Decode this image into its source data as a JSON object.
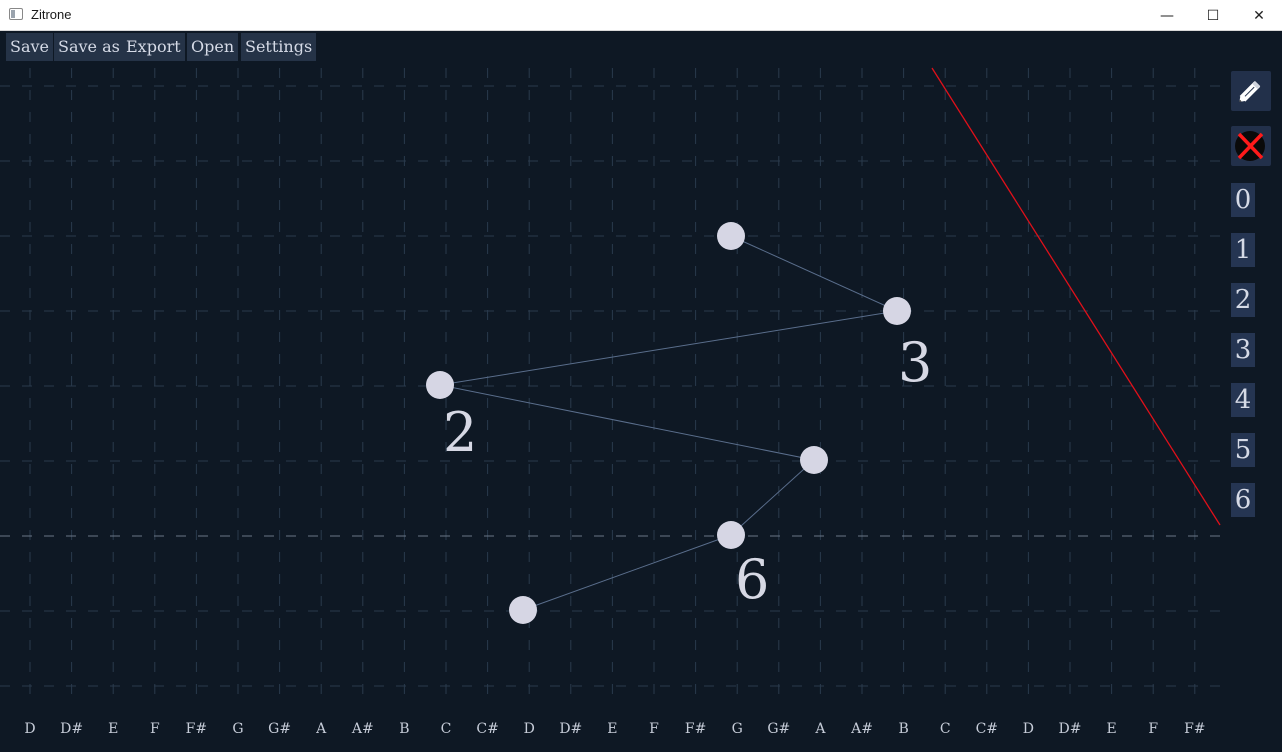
{
  "window": {
    "title": "Zitrone",
    "minimize_glyph": "—",
    "maximize_glyph": "☐",
    "close_glyph": "✕"
  },
  "menu": [
    {
      "key": "save",
      "label": "Save"
    },
    {
      "key": "save-as",
      "label": "Save as"
    },
    {
      "key": "export",
      "label": "Export"
    },
    {
      "key": "open",
      "label": "Open"
    },
    {
      "key": "settings",
      "label": "Settings"
    }
  ],
  "tools": [
    {
      "key": "pencil",
      "icon": "pencil-icon"
    },
    {
      "key": "delete",
      "icon": "red-x-icon"
    }
  ],
  "number_buttons": [
    "0",
    "1",
    "2",
    "3",
    "4",
    "5",
    "6"
  ],
  "note_labels": [
    "D",
    "D#",
    "E",
    "F",
    "F#",
    "G",
    "G#",
    "A",
    "A#",
    "B",
    "C",
    "C#",
    "D",
    "D#",
    "E",
    "F",
    "F#",
    "G",
    "G#",
    "A",
    "A#",
    "B",
    "C",
    "C#",
    "D",
    "D#",
    "E",
    "F",
    "F#"
  ],
  "node_labels": [
    "3",
    "2",
    "6"
  ],
  "colors": {
    "background": "#0e1824",
    "grid": "#2a3a4c",
    "node": "#d6d6e4",
    "edge": "#5a6e8c",
    "playhead": "#e0101a",
    "menu_bg": "#253347"
  }
}
